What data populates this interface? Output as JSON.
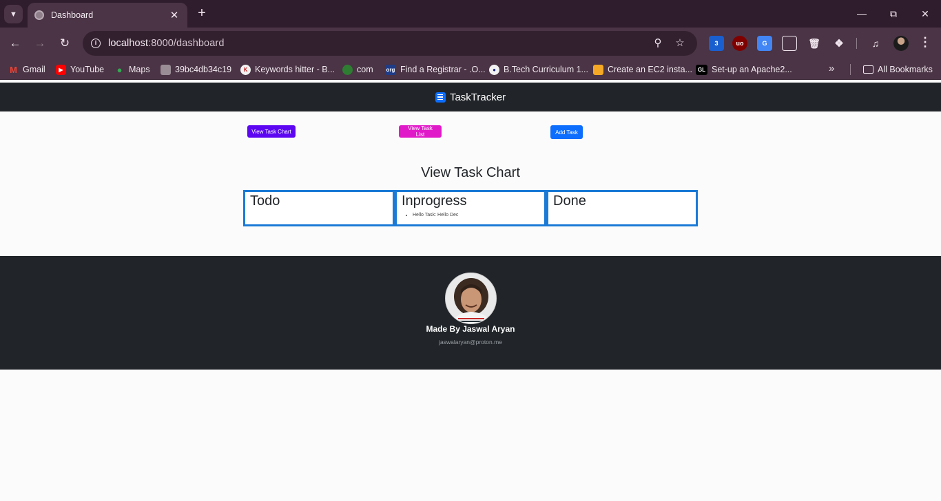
{
  "browser": {
    "tab_title": "Dashboard",
    "url_host": "localhost",
    "url_path": ":8000/dashboard",
    "bookmarks": [
      {
        "label": "Gmail",
        "icon": "gmail-icon"
      },
      {
        "label": "YouTube",
        "icon": "youtube-icon"
      },
      {
        "label": "Maps",
        "icon": "maps-icon"
      },
      {
        "label": "39bc4db34c19",
        "icon": "folder-icon"
      },
      {
        "label": "Keywords hitter - B...",
        "icon": "keywords-icon"
      },
      {
        "label": "com",
        "icon": "globe-icon"
      },
      {
        "label": "Find a Registrar - .O...",
        "icon": "org-icon"
      },
      {
        "label": "B.Tech Curriculum 1...",
        "icon": "curriculum-icon"
      },
      {
        "label": "Create an EC2 insta...",
        "icon": "aws-icon"
      },
      {
        "label": "Set-up an Apache2...",
        "icon": "gl-icon"
      }
    ],
    "all_bookmarks_label": "All Bookmarks",
    "extension_badge": "3"
  },
  "app": {
    "brand": "TaskTracker",
    "buttons": {
      "view_chart": "View Task Chart",
      "view_list": "View Task List",
      "add_task": "Add Task"
    },
    "section_title": "View Task Chart",
    "columns": [
      {
        "title": "Todo",
        "tasks": []
      },
      {
        "title": "Inprogress",
        "tasks": [
          "Hello Task: Hello Dec"
        ]
      },
      {
        "title": "Done",
        "tasks": []
      }
    ],
    "footer": {
      "made_by": "Made By Jaswal Aryan",
      "email": "jaswalaryan@proton.me"
    }
  },
  "colors": {
    "chart_button": "#5c06f2",
    "list_button": "#e11ac9",
    "add_button": "#0d6efd",
    "column_border": "#1a7ad6",
    "navbar": "#212529"
  }
}
